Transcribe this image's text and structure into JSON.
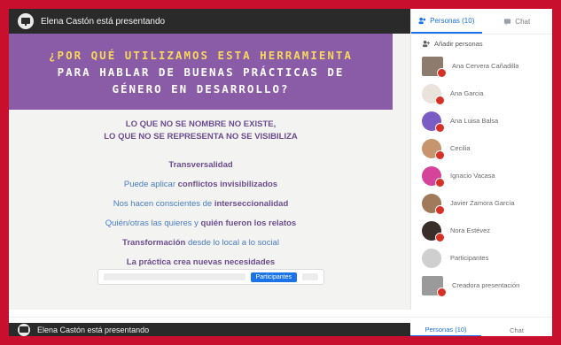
{
  "presentation": {
    "presenter_text": "Elena Castón está presentando",
    "banner_lines": [
      "¿POR QUÉ UTILIZAMOS ESTA HERRAMIENTA",
      "PARA HABLAR DE BUENAS PRÁCTICAS DE",
      "GÉNERO EN DESARROLLO?"
    ],
    "motto_lines": [
      "LO QUE NO SE NOMBRE NO EXISTE,",
      "LO QUE NO SE REPRESENTA NO SE VISIBILIZA"
    ],
    "items": [
      {
        "pre": "",
        "strong": "Transversalidad",
        "post": ""
      },
      {
        "pre": "Puede aplicar ",
        "strong": "conflictos invisibilizados",
        "post": ""
      },
      {
        "pre": "Nos hacen conscientes de ",
        "strong": "interseccionalidad",
        "post": ""
      },
      {
        "pre": "Quién/otras las quieres y ",
        "strong": "quién fueron los relatos",
        "post": ""
      },
      {
        "pre": "",
        "strong": "Transformación",
        "post": " desde lo local a lo social"
      },
      {
        "pre": "",
        "strong": "La práctica crea nuevas necesidades",
        "post": ""
      }
    ],
    "controls": {
      "button_label": "Participantes"
    }
  },
  "side_panel": {
    "tabs": [
      {
        "label": "Personas (10)",
        "active": true
      },
      {
        "label": "Chat",
        "active": false
      }
    ],
    "add_people_label": "Añadir personas",
    "participants": [
      {
        "name": "Ana Cervera Cañadilla",
        "color": "#8d7b6e",
        "shape": "rect"
      },
      {
        "name": "Ana Garcia",
        "color": "#e9e3dc",
        "shape": "round"
      },
      {
        "name": "Ana Luisa Balsa",
        "color": "#7b5cc4",
        "shape": "round"
      },
      {
        "name": "Cecilia",
        "color": "#c7956d",
        "shape": "round"
      },
      {
        "name": "Ignacio Vacasa",
        "color": "#d5439a",
        "shape": "round"
      },
      {
        "name": "Javier Zamora García",
        "color": "#a07a5a",
        "shape": "round"
      },
      {
        "name": "Nora Estévez",
        "color": "#3a2e2a",
        "shape": "round"
      },
      {
        "name": "Participantes",
        "color": "#cfcfcf",
        "shape": "round"
      },
      {
        "name": "Creadora presentación",
        "color": "#9a9a9a",
        "shape": "rect"
      }
    ]
  },
  "bottom": {
    "presenter_text": "Elena Castón está presentando",
    "tabs": [
      {
        "label": "Personas (10)"
      },
      {
        "label": "Chat"
      }
    ]
  },
  "colors": {
    "frame": "#c8102e",
    "banner": "#8a5ba6",
    "accent": "#1a73e8"
  }
}
